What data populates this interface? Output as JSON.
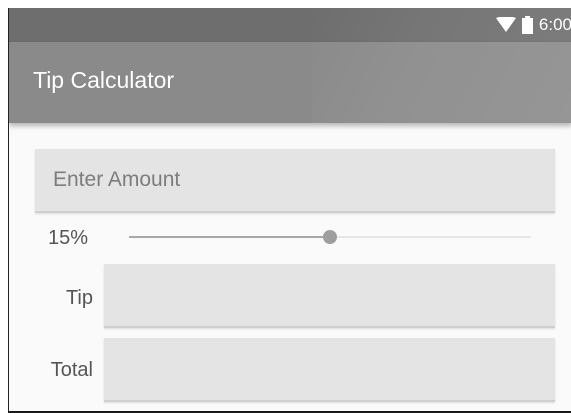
{
  "status_bar": {
    "time": "6:00",
    "icons": [
      "wifi-icon",
      "battery-icon"
    ]
  },
  "app_bar": {
    "title": "Tip Calculator"
  },
  "amount_input": {
    "value": "",
    "placeholder": "Enter Amount"
  },
  "tip_slider": {
    "label": "15%",
    "value_fraction": 0.5
  },
  "tip_row": {
    "label": "Tip",
    "value": ""
  },
  "total_row": {
    "label": "Total",
    "value": ""
  },
  "colors": {
    "status_bar": "#6e6e6e",
    "app_bar": "#8a8a8a",
    "background": "#fafafa",
    "field": "#e4e4e4",
    "slider_active": "#9e9e9e"
  }
}
